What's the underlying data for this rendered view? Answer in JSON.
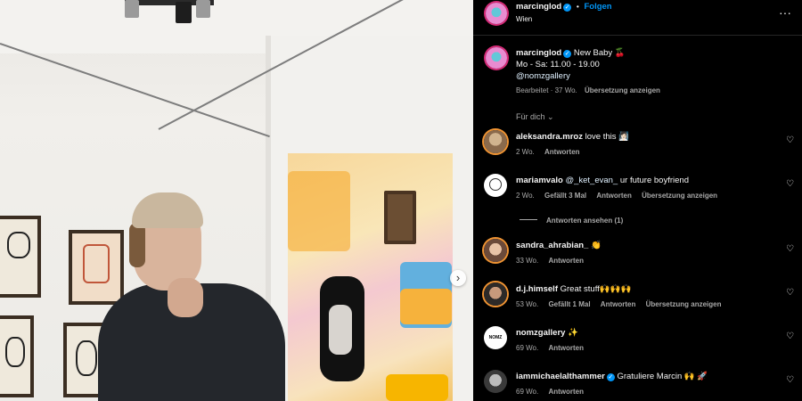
{
  "post": {
    "next_icon": "chevron-right-icon",
    "next_glyph": "›"
  },
  "header": {
    "username": "marcinglod",
    "verified_glyph": "✓",
    "dot": "•",
    "follow_label": "Folgen",
    "location": "Wien",
    "more_icon": "more-horizontal-icon",
    "more_glyph": "···"
  },
  "caption": {
    "username": "marcinglod",
    "title": "New Baby 🍒",
    "hours": "Mo - Sa: 11.00 - 19.00",
    "mention": "@nomzgallery",
    "edited": "Bearbeitet · 37 Wo.",
    "translate": "Übersetzung anzeigen"
  },
  "filter": {
    "label": "Für dich",
    "icon": "chevron-down-icon",
    "glyph": "⌄"
  },
  "heart_glyph": "♡",
  "comments": [
    {
      "username": "aleksandra.mroz",
      "text": "love this 🧖🏻‍♀️",
      "time": "2 Wo.",
      "reply": "Antworten"
    },
    {
      "username": "mariamvalo",
      "mention": "@_ket_evan_",
      "text": "ur future boyfriend",
      "time": "2 Wo.",
      "likes": "Gefällt 3 Mal",
      "reply": "Antworten",
      "translate": "Übersetzung anzeigen"
    },
    {
      "username": "sandra_ahrabian_",
      "text": "👏",
      "time": "33 Wo.",
      "reply": "Antworten"
    },
    {
      "username": "d.j.himself",
      "text": "Great stuff🙌🙌🙌",
      "time": "53 Wo.",
      "likes": "Gefällt 1 Mal",
      "reply": "Antworten",
      "translate": "Übersetzung anzeigen"
    },
    {
      "username": "nomzgallery",
      "text": "✨",
      "time": "69 Wo.",
      "reply": "Antworten",
      "avatar_text": "NOMZ"
    },
    {
      "username": "iammichaelalthammer",
      "text": "Gratuliere Marcin 🙌 🚀",
      "time": "69 Wo.",
      "reply": "Antworten"
    }
  ],
  "view_replies": "Antworten ansehen (1)",
  "colors": {
    "background": "#000000",
    "text": "#f5f5f5",
    "muted": "#a8a8a8",
    "accent_blue": "#0095f6"
  }
}
